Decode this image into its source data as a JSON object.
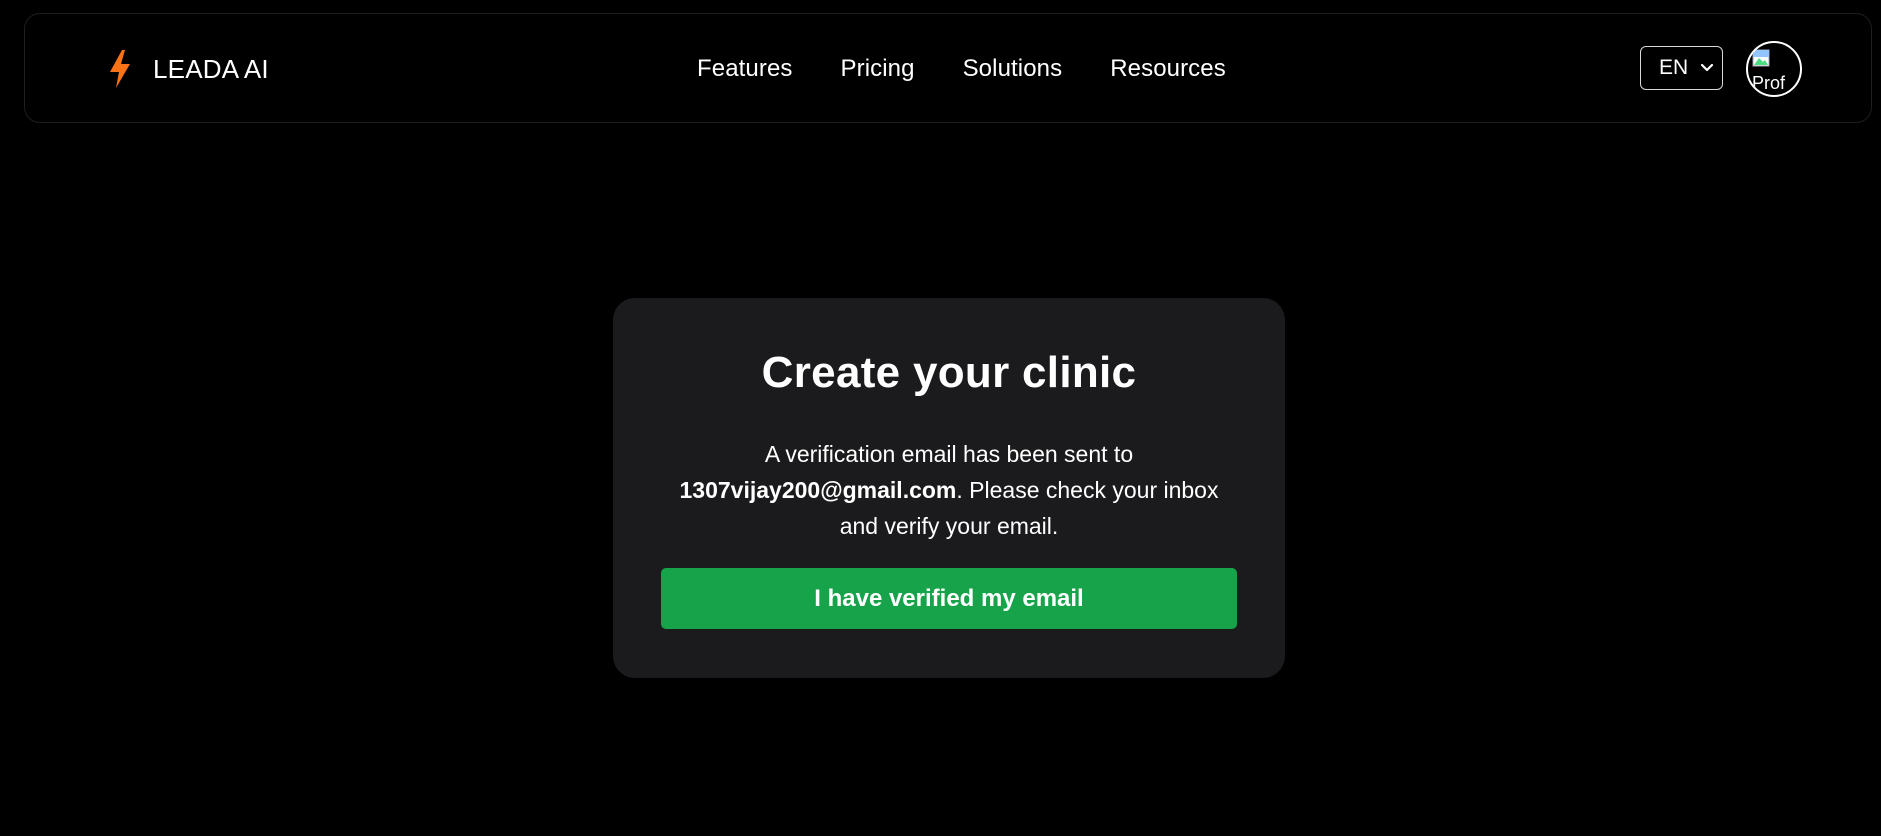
{
  "header": {
    "brand_name": "LEADA AI",
    "brand_icon": "lightning-bolt-icon",
    "brand_icon_color": "#f97316",
    "nav": [
      {
        "label": "Features"
      },
      {
        "label": "Pricing"
      },
      {
        "label": "Solutions"
      },
      {
        "label": "Resources"
      }
    ],
    "language": {
      "selected": "EN",
      "icon": "chevron-down-icon"
    },
    "avatar": {
      "alt_text": "Prof"
    }
  },
  "card": {
    "title": "Create your clinic",
    "message_prefix": "A verification email has been sent to",
    "email": "1307vijay200@gmail.com",
    "message_suffix": ". Please check your inbox and verify your email.",
    "button_label": "I have verified my email",
    "button_color": "#16a34a",
    "background": "#1b1b1d"
  }
}
